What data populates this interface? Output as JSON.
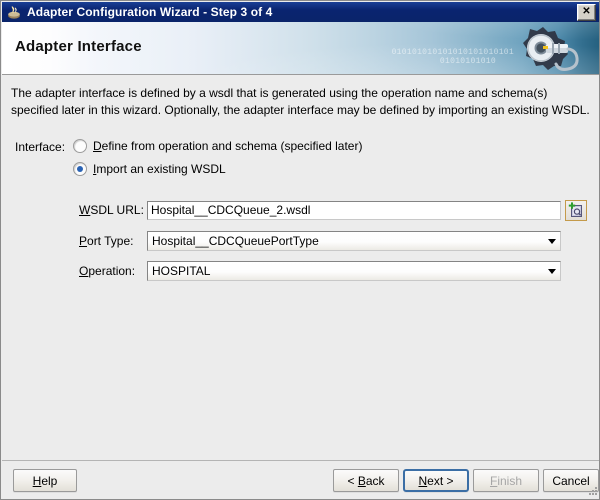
{
  "window": {
    "title": "Adapter Configuration Wizard - Step 3 of 4",
    "icon": "wizard-icon",
    "close_label": "✕"
  },
  "banner": {
    "heading": "Adapter Interface",
    "binary_row1": "010101010101010101010101",
    "binary_row2": "01010101010",
    "graphic": "gear-plug-icon"
  },
  "description": "The adapter interface is defined by a wsdl that is generated using the operation name and schema(s) specified later in this wizard.  Optionally, the adapter interface may be defined by importing an existing WSDL.",
  "form": {
    "interface_label": "Interface:",
    "options": [
      {
        "mnemonic": "D",
        "rest": "efine from operation and schema (specified later)",
        "selected": false
      },
      {
        "mnemonic": "I",
        "rest": "mport an existing WSDL",
        "selected": true
      }
    ],
    "wsdl": {
      "mnemonic": "W",
      "label_rest": "SDL URL:",
      "value": "Hospital__CDCQueue_2.wsdl",
      "browse_icon": "browse-wsdl-icon"
    },
    "port_type": {
      "mnemonic": "P",
      "label_rest": "ort Type:",
      "value": "Hospital__CDCQueuePortType"
    },
    "operation": {
      "mnemonic": "O",
      "label_rest": "peration:",
      "value": "HOSPITAL"
    }
  },
  "footer": {
    "help": "Help",
    "help_mnemonic": "H",
    "back": "< Back",
    "back_mnemonic": "B",
    "next": "Next >",
    "next_mnemonic": "N",
    "finish": "Finish",
    "finish_mnemonic": "F",
    "cancel": "Cancel"
  },
  "colors": {
    "titlebar": "#0a246a",
    "banner_accent": "#25607f",
    "dialog_bg": "#ececec",
    "radio_dot": "#2a63b4",
    "focus_border": "#3b6ea5",
    "browse_border": "#c49a4a"
  }
}
